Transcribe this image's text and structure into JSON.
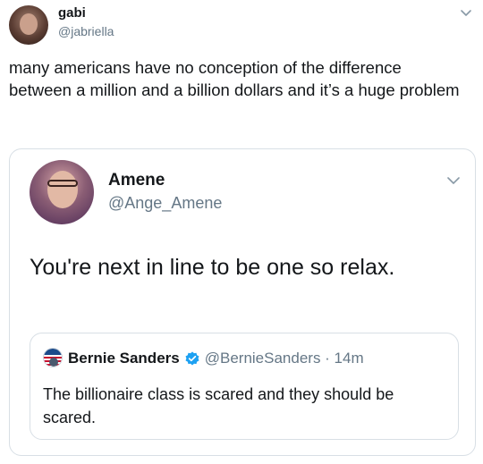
{
  "outer_tweet": {
    "name": "gabi",
    "handle": "@jabriella",
    "text": "many americans have no conception of the difference between a million and a billion dollars and it’s a huge problem"
  },
  "quoted_tweet": {
    "name": "Amene",
    "handle": "@Ange_Amene",
    "text": "You're next in line to be one so relax.",
    "nested_quote": {
      "name": "Bernie Sanders",
      "meta": "@BernieSanders · 14m",
      "text": "The billionaire class is scared and they should be scared."
    }
  },
  "icons": {
    "chevron": "chevron-down-icon",
    "verified": "verified-badge-icon"
  },
  "colors": {
    "text": "#14171a",
    "secondary": "#657786",
    "border": "#d8dfe5",
    "verified": "#1da1f2"
  }
}
